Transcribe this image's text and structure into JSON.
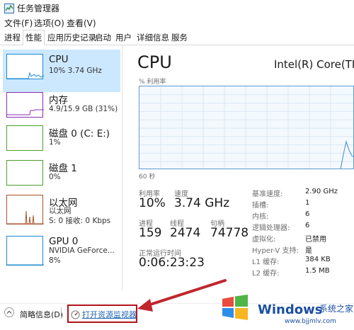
{
  "window": {
    "title": "任务管理器",
    "menu": [
      "文件(F)",
      "选项(O)",
      "查看(V)"
    ]
  },
  "tabs": [
    {
      "label": "进程",
      "active": false
    },
    {
      "label": "性能",
      "active": true
    },
    {
      "label": "应用历史记录",
      "active": false
    },
    {
      "label": "启动",
      "active": false
    },
    {
      "label": "用户",
      "active": false
    },
    {
      "label": "详细信息",
      "active": false
    },
    {
      "label": "服务",
      "active": false
    }
  ],
  "sidebar": {
    "items": [
      {
        "title": "CPU",
        "sub1": "10%  3.74 GHz",
        "sub2": "",
        "sub3": "",
        "selected": true
      },
      {
        "title": "内存",
        "sub1": "4.9/15.9 GB (31%)",
        "sub2": "",
        "sub3": "",
        "selected": false
      },
      {
        "title": "磁盘 0 (C: E:)",
        "sub1": "1%",
        "sub2": "",
        "sub3": "",
        "selected": false
      },
      {
        "title": "磁盘 1",
        "sub1": "0%",
        "sub2": "",
        "sub3": "",
        "selected": false
      },
      {
        "title": "以太网",
        "sub1": "以太网",
        "sub2": "S: 0 接收: 0 Kbps",
        "sub3": "",
        "selected": false
      },
      {
        "title": "GPU 0",
        "sub1": "NVIDIA GeForce...",
        "sub2": "8%",
        "sub3": "",
        "selected": false
      }
    ]
  },
  "main": {
    "title": "CPU",
    "model": "Intel(R) Core(TM) i",
    "util_label": "% 利用率",
    "time_label": "60 秒",
    "stats": {
      "utilization_label": "利用率",
      "utilization": "10%",
      "speed_label": "速度",
      "speed": "3.74 GHz",
      "processes_label": "进程",
      "processes": "159",
      "threads_label": "线程",
      "threads": "2474",
      "handles_label": "句柄",
      "handles": "74778",
      "uptime_label": "正常运行时间",
      "uptime": "0:06:23:23"
    },
    "specs": [
      {
        "label": "基准速度:",
        "value": "2.90 GHz"
      },
      {
        "label": "插槽:",
        "value": "1"
      },
      {
        "label": "内核:",
        "value": "6"
      },
      {
        "label": "逻辑处理器:",
        "value": "6"
      },
      {
        "label": "虚拟化:",
        "value": "已禁用"
      },
      {
        "label": "Hyper-V 支持:",
        "value": "是"
      },
      {
        "label": "L1 缓存:",
        "value": "384 KB"
      },
      {
        "label": "L2 缓存:",
        "value": "1.5 MB"
      }
    ]
  },
  "footer": {
    "fewer_details": "简略信息(D)",
    "open_resmon": "打开资源监视器"
  },
  "watermark": {
    "brand": "Windows",
    "cn": "系统之家",
    "url": "www.bjjmlv.com"
  },
  "colors": {
    "cpu": "#1a8ad1",
    "memory": "#8b2fb0",
    "disk": "#4aa02c",
    "ethernet": "#a7522a",
    "gpu": "#1a8ad1",
    "highlight": "#b3141b",
    "link": "#1f63b5"
  }
}
